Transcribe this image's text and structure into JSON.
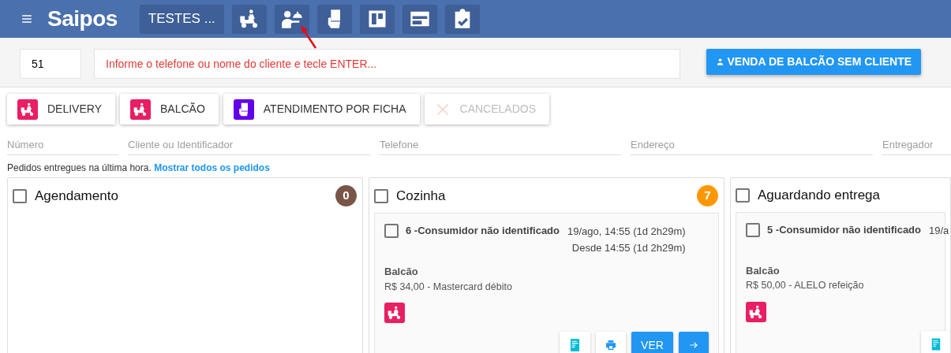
{
  "navbar": {
    "logo": "Saipos",
    "store": "TESTES ...",
    "shortcuts": [
      {
        "kind": "delivery"
      },
      {
        "kind": "waiter"
      },
      {
        "kind": "ticket"
      },
      {
        "kind": "kanban"
      },
      {
        "kind": "panel"
      },
      {
        "kind": "checklist"
      }
    ]
  },
  "order_entry": {
    "order_number": "51",
    "placeholder": "Informe o telefone ou nome do cliente e tecle ENTER...",
    "counter_button": "VENDA DE BALCÃO SEM CLIENTE"
  },
  "tabs": [
    {
      "label": "DELIVERY",
      "kind": "delivery",
      "disabled": false
    },
    {
      "label": "BALCÃO",
      "kind": "delivery",
      "disabled": false
    },
    {
      "label": "ATENDIMENTO POR FICHA",
      "kind": "ticket",
      "disabled": false
    },
    {
      "label": "CANCELADOS",
      "kind": "cancel",
      "disabled": true
    }
  ],
  "filters": [
    {
      "placeholder": "Número"
    },
    {
      "placeholder": "Cliente ou Identificador"
    },
    {
      "placeholder": "Telefone"
    },
    {
      "placeholder": "Endereço"
    },
    {
      "placeholder": "Entregador"
    }
  ],
  "notice": {
    "text": "Pedidos entregues na última hora.",
    "link": "Mostrar todos os pedidos"
  },
  "columns": [
    {
      "title": "Agendamento",
      "checked": false,
      "count": "0",
      "color": "#795548"
    },
    {
      "title": "Cozinha",
      "checked": false,
      "count": "7",
      "color": "#ff9800",
      "orders": [
        {
          "checked": false,
          "title": "6 -Consumidor não identificado",
          "time": "19/ago, 14:55 (1d 2h29m)",
          "since": "Desde 14:55 (1d 2h29m)",
          "type": "Balcão",
          "payment": "R$ 34,00 - Mastercard débito",
          "actions": [
            {
              "kind": "receipt"
            },
            {
              "kind": "print"
            },
            {
              "kind": "view",
              "label": "VER"
            },
            {
              "kind": "next"
            }
          ]
        }
      ]
    },
    {
      "title": "Aguardando entrega",
      "checked": false,
      "orders": [
        {
          "checked": false,
          "title": "5 -Consumidor não identificado",
          "time": "19/a",
          "type": "Balcão",
          "payment": "R$ 50,00 - ALELO refeição",
          "actions": [
            {
              "kind": "receipt"
            }
          ]
        }
      ]
    }
  ]
}
